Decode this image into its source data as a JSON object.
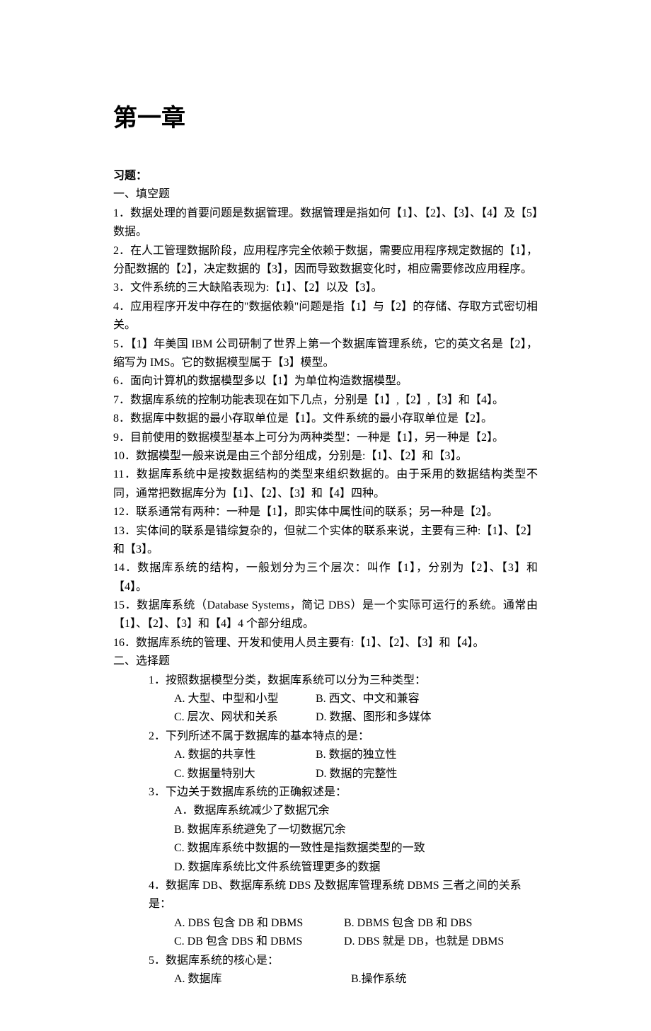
{
  "chapter_title": "第一章",
  "exercise_label": "习题：",
  "section_fill_label": "一、填空题",
  "fill_items": [
    "1．数据处理的首要问题是数据管理。数据管理是指如何【1】、【2】、【3】、【4】及【5】数据。",
    "2．在人工管理数据阶段，应用程序完全依赖于数据，需要应用程序规定数据的【1】，分配数据的【2】，决定数据的【3】，因而导致数据变化时，相应需要修改应用程序。",
    "3．文件系统的三大缺陷表现为:【1】、【2】以及【3】。",
    "4．应用程序开发中存在的\"数据依赖\"问题是指【1】与【2】的存储、存取方式密切相关。",
    "5．【1】年美国 IBM 公司研制了世界上第一个数据库管理系统，它的英文名是【2】，缩写为 IMS。它的数据模型属于【3】模型。",
    "6．面向计算机的数据模型多以【1】为单位构造数据模型。",
    "7．数据库系统的控制功能表现在如下几点，分别是【1】,【2】,【3】和【4】。",
    "8．数据库中数据的最小存取单位是【1】。文件系统的最小存取单位是【2】。",
    "9．目前使用的数据模型基本上可分为两种类型：一种是【1】，另一种是【2】。",
    "10．数据模型一般来说是由三个部分组成，分别是:【1】、【2】和【3】。",
    "11．数据库系统中是按数据结构的类型来组织数据的。由于采用的数据结构类型不同，通常把数据库分为【1】、【2】、【3】和【4】四种。",
    "12．联系通常有两种：一种是【1】，即实体中属性间的联系；另一种是【2】。",
    "13．实体间的联系是错综复杂的，但就二个实体的联系来说，主要有三种:【1】、【2】和【3】。",
    "14．数据库系统的结构，一般划分为三个层次：叫作【1】，分别为【2】、【3】和【4】。",
    "15．数据库系统（Database Systems，简记 DBS）是一个实际可运行的系统。通常由【1】、【2】、【3】和【4】4 个部分组成。",
    "16．数据库系统的管理、开发和使用人员主要有:【1】、【2】、【3】和【4】。"
  ],
  "section_choice_label": "二、选择题",
  "choice_questions": [
    {
      "q": "1．按照数据模型分类，数据库系统可以分为三种类型：",
      "rows": [
        [
          {
            "t": "A.  大型、中型和小型",
            "w": "w1"
          },
          {
            "t": "B.  西文、中文和兼容",
            "w": "w2"
          }
        ],
        [
          {
            "t": "C.  层次、网状和关系",
            "w": "w1"
          },
          {
            "t": "D.  数据、图形和多媒体",
            "w": "w2"
          }
        ]
      ]
    },
    {
      "q": "2．下列所述不属于数据库的基本特点的是：",
      "rows": [
        [
          {
            "t": "A.  数据的共享性",
            "w": "w1"
          },
          {
            "t": "B.  数据的独立性",
            "w": "w2"
          }
        ],
        [
          {
            "t": "C.  数据量特别大",
            "w": "w1"
          },
          {
            "t": "D.  数据的完整性",
            "w": "w2"
          }
        ]
      ]
    },
    {
      "q": "3．下边关于数据库系统的正确叙述是：",
      "rows": [
        [
          {
            "t": "A．数据库系统减少了数据冗余",
            "w": "wlong"
          }
        ],
        [
          {
            "t": "B.  数据库系统避免了一切数据冗余",
            "w": "wlong"
          }
        ],
        [
          {
            "t": "C.  数据库系统中数据的一致性是指数据类型的一致",
            "w": "wlong"
          }
        ],
        [
          {
            "t": "D.  数据库系统比文件系统管理更多的数据",
            "w": "wlong"
          }
        ]
      ]
    },
    {
      "q": "4．数据库 DB、数据库系统 DBS 及数据库管理系统 DBMS 三者之间的关系是：",
      "rows": [
        [
          {
            "t": "A. DBS 包含 DB 和 DBMS",
            "w": "w3"
          },
          {
            "t": "B. DBMS 包含 DB 和 DBS",
            "w": "w4"
          }
        ],
        [
          {
            "t": "C. DB 包含 DBS 和 DBMS",
            "w": "w3"
          },
          {
            "t": "D. DBS 就是 DB，也就是 DBMS",
            "w": "w4"
          }
        ]
      ]
    },
    {
      "q": "5．数据库系统的核心是：",
      "rows": [
        [
          {
            "t": "A.  数据库",
            "w": "w5"
          },
          {
            "t": "B.操作系统",
            "w": "w5"
          }
        ]
      ]
    }
  ]
}
